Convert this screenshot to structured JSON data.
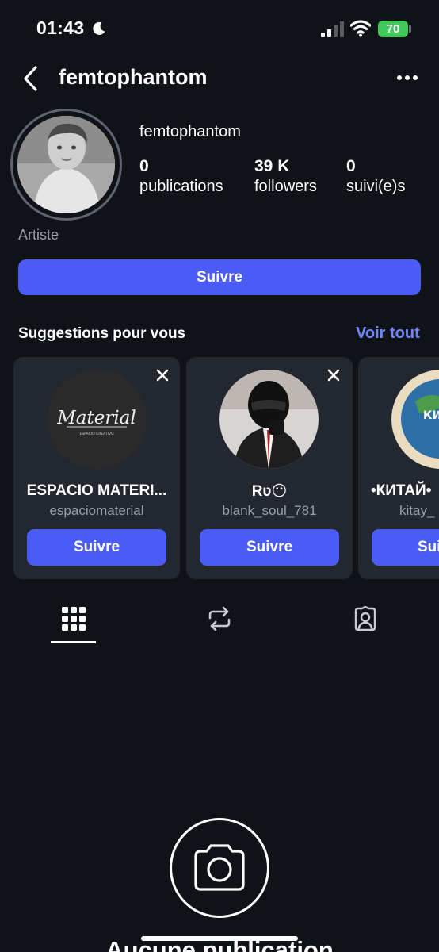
{
  "status_bar": {
    "time": "01:43",
    "battery": "70",
    "icons": [
      "moon-icon",
      "signal-icon",
      "wifi-icon",
      "battery-icon"
    ]
  },
  "header": {
    "title": "femtophantom",
    "back_icon": "chevron-left-icon",
    "more_icon": "more-horizontal-icon"
  },
  "profile": {
    "username": "femtophantom",
    "stats": [
      {
        "value": "0",
        "label": "publications"
      },
      {
        "value": "39 K",
        "label": "followers"
      },
      {
        "value": "0",
        "label": "suivi(e)s"
      }
    ],
    "category": "Artiste",
    "follow_label": "Suivre"
  },
  "suggestions": {
    "title": "Suggestions pour vous",
    "see_all": "Voir tout",
    "cards": [
      {
        "name": "ESPACIO MATERI...",
        "handle": "espaciomaterial",
        "button": "Suivre",
        "logo_text": "Material",
        "logo_subtext": "ESPACIO CREATIVO"
      },
      {
        "name": "Rʋ😶",
        "handle": "blank_soul_781",
        "button": "Suivre"
      },
      {
        "name": "•КИТАЙ•",
        "handle": "kitay_",
        "button": "Sui",
        "logo_text": "КИ ЛЕТ"
      }
    ]
  },
  "tabs": [
    {
      "icon": "grid-icon",
      "active": true
    },
    {
      "icon": "repost-icon",
      "active": false
    },
    {
      "icon": "tagged-icon",
      "active": false
    }
  ],
  "empty_state": {
    "icon": "camera-icon",
    "title": "Aucune publication"
  },
  "colors": {
    "background": "#0f1217",
    "accent": "#4a5cf5",
    "link": "#6f86ff",
    "card": "#222730",
    "battery": "#3ec95a"
  }
}
